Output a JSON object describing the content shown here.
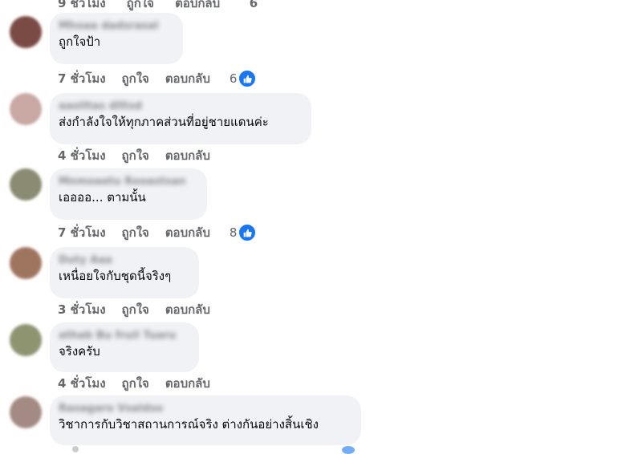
{
  "top_partial": {
    "time": "9 ชั่วโมง",
    "like": "ถูกใจ",
    "reply": "ตอบกลับ",
    "count": "6"
  },
  "comments": [
    {
      "author": "Mhoaa dadsrasal",
      "text": "ถูกใจป้า",
      "time": "7 ชั่วโมง",
      "like": "ถูกใจ",
      "reply": "ตอบกลับ",
      "count": "6",
      "avatar_color": "#7a4a44"
    },
    {
      "author": "aaolitas dlltsd",
      "text": "ส่งกำลังใจให้ทุกภาคส่วนที่อยู่ชายแดนค่ะ",
      "time": "4 ชั่วโมง",
      "like": "ถูกใจ",
      "reply": "ตอบกลับ",
      "count": "",
      "avatar_color": "#c9a7a2"
    },
    {
      "author": "Mnmoaetu Rooastsan",
      "text": "เออออ... ตามนั้น",
      "time": "7 ชั่วโมง",
      "like": "ถูกใจ",
      "reply": "ตอบกลับ",
      "count": "8",
      "avatar_color": "#8b8a72"
    },
    {
      "author": "Duty Aaa",
      "text": "เหนื่อยใจกับชุดนี้จริงๆ",
      "time": "3 ชั่วโมง",
      "like": "ถูกใจ",
      "reply": "ตอบกลับ",
      "count": "",
      "avatar_color": "#a07560"
    },
    {
      "author": "athab Bu fruil Tuaru",
      "text": "จริงครับ",
      "time": "4 ชั่วโมง",
      "like": "ถูกใจ",
      "reply": "ตอบกลับ",
      "count": "",
      "avatar_color": "#8f9470"
    },
    {
      "author": "Rasagaro Vsaldso",
      "text": "วิชาการกับวิชาสถานการณ์จริง ต่างกันอย่างสิ้นเชิง",
      "time": "",
      "like": "",
      "reply": "",
      "count": "",
      "avatar_color": "#a38b84"
    }
  ]
}
